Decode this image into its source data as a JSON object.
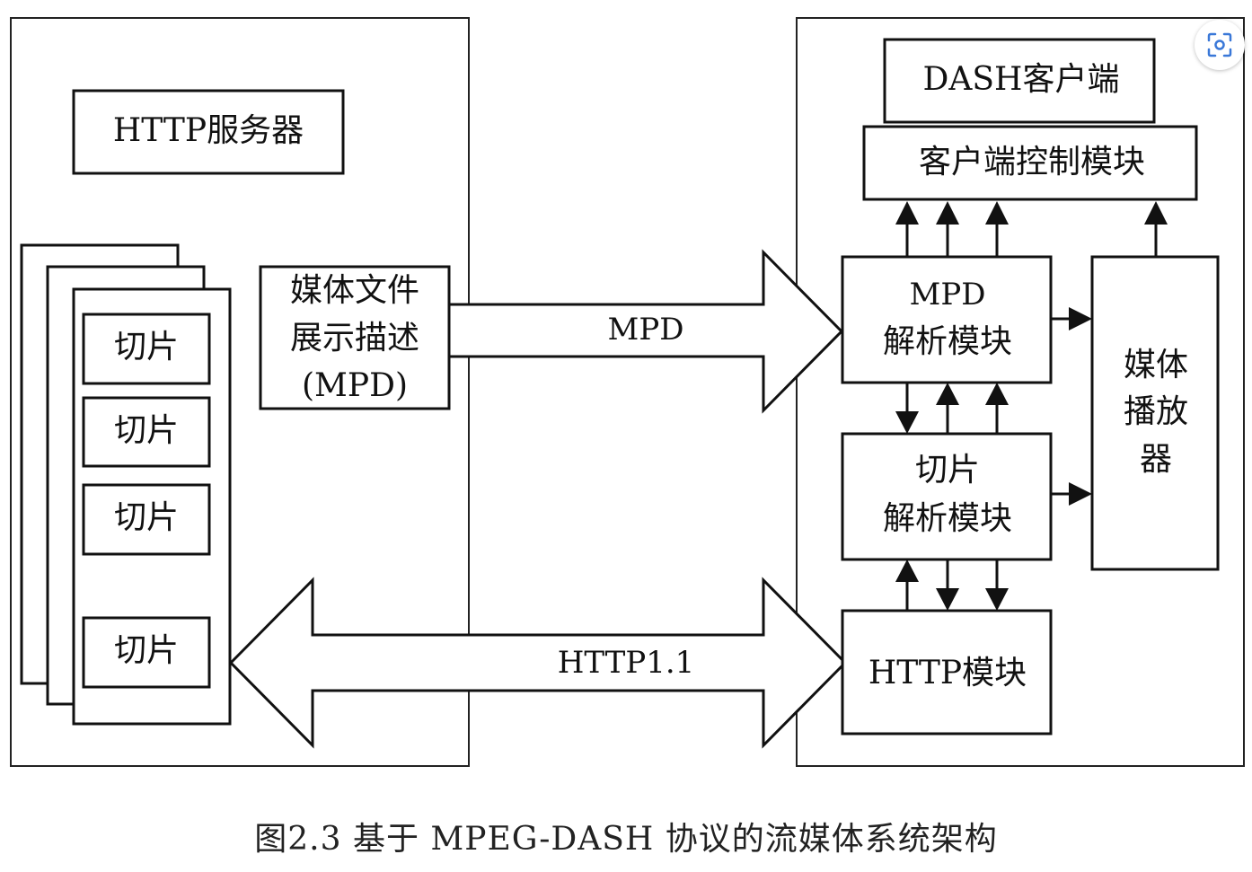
{
  "server": {
    "title": "HTTP服务器",
    "segments": [
      "切片",
      "切片",
      "切片",
      "切片"
    ],
    "mpd_lines": [
      "媒体文件",
      "展示描述",
      "(MPD)"
    ]
  },
  "client": {
    "title": "DASH客户端",
    "control": "客户端控制模块",
    "mpd_parser_lines": [
      "MPD",
      "解析模块"
    ],
    "segment_parser_lines": [
      "切片",
      "解析模块"
    ],
    "http_module": "HTTP模块",
    "player_lines": [
      "媒体",
      "播放",
      "器"
    ]
  },
  "links": {
    "mpd": "MPD",
    "http": "HTTP1.1"
  },
  "caption": "图2.3  基于 MPEG-DASH 协议的流媒体系统架构",
  "icons": {
    "scan": "scan-icon"
  }
}
